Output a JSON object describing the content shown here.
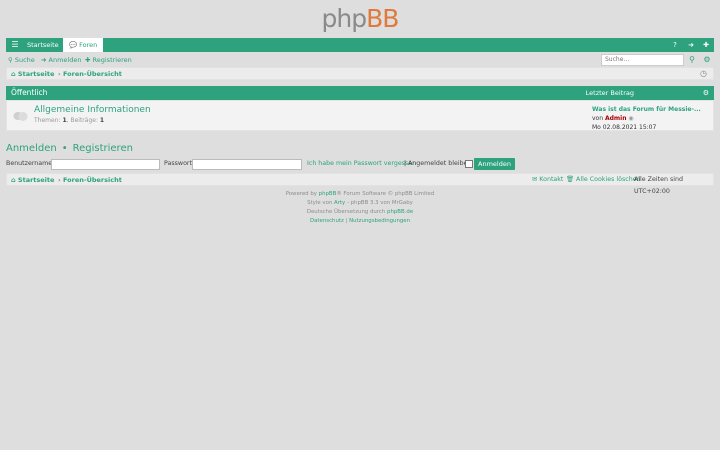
{
  "logo": {
    "part1": "php",
    "part2": "BB"
  },
  "navbar": {
    "home": "Startseite",
    "forums": "Foren"
  },
  "subnav": {
    "search": "Suche",
    "login": "Anmelden",
    "register": "Registrieren"
  },
  "search": {
    "placeholder": "Suche…"
  },
  "breadcrumb": {
    "home": "Startseite",
    "separator": "›",
    "index": "Foren-Übersicht"
  },
  "forum_table": {
    "category": "Öffentlich",
    "last_post_header": "Letzter Beitrag",
    "rows": [
      {
        "title": "Allgemeine Informationen",
        "topics_label": "Themen:",
        "topics": "1",
        "posts_label": "Beiträge:",
        "posts": "1",
        "last_title": "Was ist das Forum für Messie-...",
        "last_by": "von",
        "last_author": "Admin",
        "last_date": "Mo 02.08.2021 15:07"
      }
    ]
  },
  "login_section": {
    "login": "Anmelden",
    "bullet": "•",
    "register": "Registrieren",
    "username_label": "Benutzername:",
    "password_label": "Passwort:",
    "forgot": "Ich habe mein Passwort vergessen",
    "pipe": "|",
    "remember": "Angemeldet bleiben",
    "submit": "Anmelden"
  },
  "footer_bar": {
    "home": "Startseite",
    "separator": "›",
    "index": "Foren-Übersicht",
    "contact": "Kontakt",
    "delete_cookies": "Alle Cookies löschen",
    "timezone": "Alle Zeiten sind UTC+02:00"
  },
  "copyright": {
    "line1_pre": "Powered by",
    "line1_link": "phpBB",
    "line1_post": "® Forum Software © phpBB Limited",
    "line2_pre": "Style von",
    "line2_link": "Arty",
    "line2_post": "- phpBB 3.3 von MrGaby",
    "line3_pre": "Deutsche Übersetzung durch",
    "line3_link": "phpBB.de",
    "privacy": "Datenschutz",
    "pipe": "|",
    "terms": "Nutzungsbedingungen"
  },
  "colors": {
    "accent": "#2da27d",
    "background": "#dedede",
    "author": "#aa0000",
    "logo_bb": "#e07a3c"
  }
}
